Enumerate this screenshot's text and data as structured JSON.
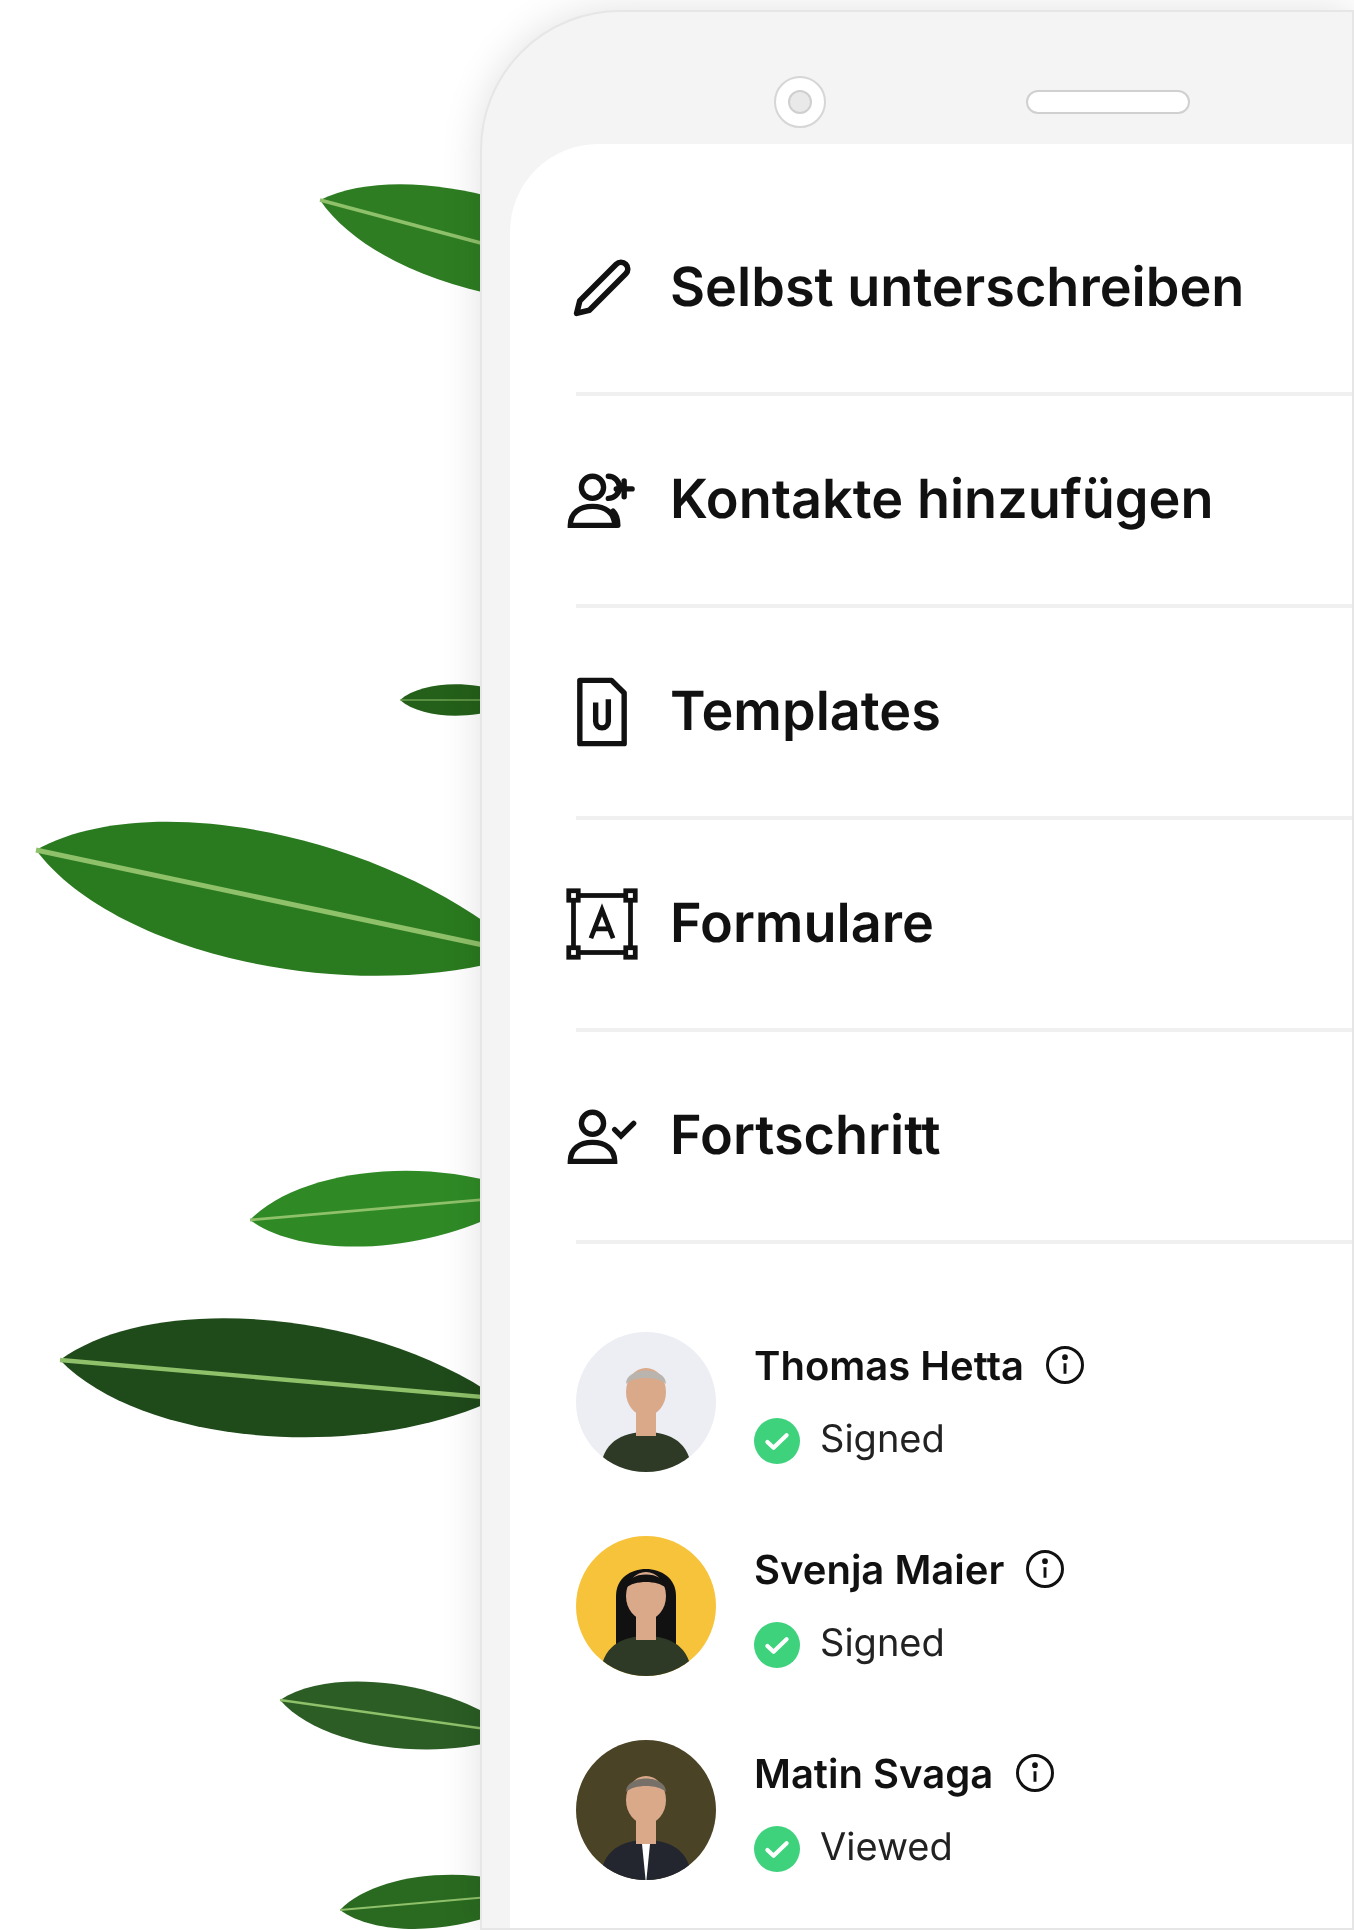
{
  "menu": [
    {
      "label": "Selbst unterschreiben"
    },
    {
      "label": "Kontakte hinzufügen"
    },
    {
      "label": "Templates"
    },
    {
      "label": "Formulare"
    },
    {
      "label": "Fortschritt"
    }
  ],
  "signers": [
    {
      "name": "Thomas Hetta",
      "status": "Signed"
    },
    {
      "name": "Svenja Maier",
      "status": "Signed"
    },
    {
      "name": "Matin Svaga",
      "status": "Viewed"
    }
  ]
}
